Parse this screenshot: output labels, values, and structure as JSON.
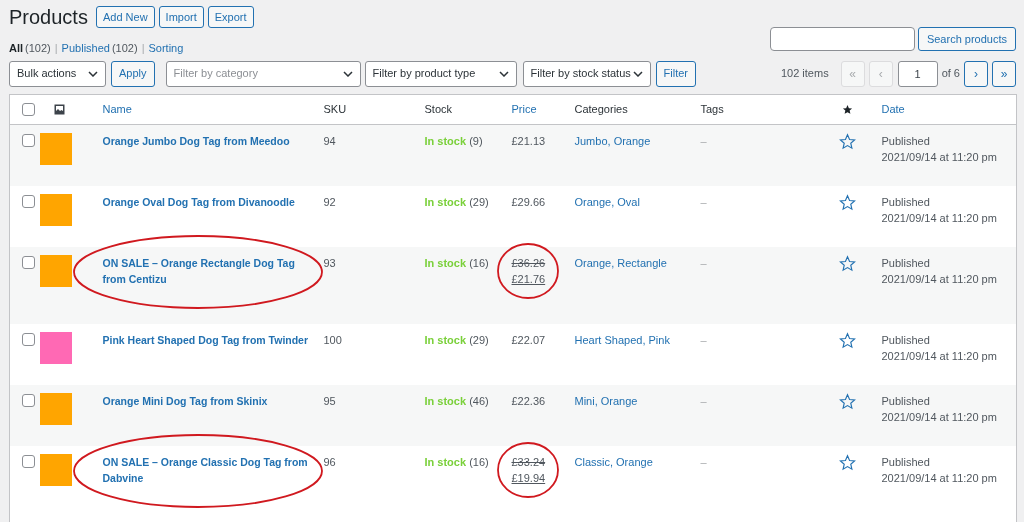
{
  "title": "Products",
  "header_buttons": [
    "Add New",
    "Import",
    "Export"
  ],
  "views": [
    {
      "label": "All",
      "count": "(102)",
      "selected": true
    },
    {
      "separator": "|",
      "label": "Published",
      "count": "(102)",
      "selected": false
    },
    {
      "separator": "|",
      "label": "Sorting",
      "selected": false
    }
  ],
  "select_all_checked": false,
  "search": {
    "button": "Search products"
  },
  "filters": {
    "bulk": "Bulk actions",
    "apply": "Apply",
    "selects": [
      "Filter by category",
      "Filter by product type",
      "Filter by stock status"
    ],
    "filter": "Filter"
  },
  "pagination": {
    "items": "102 items",
    "first": "«",
    "prev": "‹",
    "page": "1",
    "of": "of 6",
    "next": "›",
    "last": "»",
    "first_disabled": true,
    "prev_disabled": true
  },
  "table": {
    "columns": [
      "Name",
      "SKU",
      "Stock",
      "Price",
      "Categories",
      "Tags",
      "Date"
    ],
    "rows": [
      {
        "checked": false,
        "name": "Orange Jumbo Dog Tag from Meedoo",
        "sku": "94",
        "stock": "In stock",
        "qty": "(9)",
        "price": "£21.13",
        "categories": "Jumbo, Orange",
        "tags": "–",
        "featured": false,
        "date_status": "Published",
        "date": "2021/09/14 at 11:20 pm",
        "color": "#ffa500",
        "circled": false
      },
      {
        "checked": false,
        "name": "Orange Oval Dog Tag from Divanoodle",
        "sku": "92",
        "stock": "In stock",
        "qty": "(29)",
        "price": "£29.66",
        "categories": "Orange, Oval",
        "tags": "–",
        "featured": false,
        "date_status": "Published",
        "date": "2021/09/14 at 11:20 pm",
        "color": "#ffa500",
        "circled": false
      },
      {
        "checked": false,
        "name": "ON SALE – Orange Rectangle Dog Tag from Centizu",
        "sku": "93",
        "stock": "In stock",
        "qty": "(16)",
        "regular_price": "£36.26",
        "price": "£21.76",
        "categories": "Orange, Rectangle",
        "tags": "–",
        "featured": false,
        "date_status": "Published",
        "date": "2021/09/14 at 11:20 pm",
        "color": "#ffa500",
        "circled": true
      },
      {
        "checked": false,
        "name": "Pink Heart Shaped Dog Tag from Twinder",
        "sku": "100",
        "stock": "In stock",
        "qty": "(29)",
        "price": "£22.07",
        "categories": "Heart Shaped, Pink",
        "tags": "–",
        "featured": false,
        "date_status": "Published",
        "date": "2021/09/14 at 11:20 pm",
        "color": "#ff69b4",
        "circled": false
      },
      {
        "checked": false,
        "name": "Orange Mini Dog Tag from Skinix",
        "sku": "95",
        "stock": "In stock",
        "qty": "(46)",
        "price": "£22.36",
        "categories": "Mini, Orange",
        "tags": "–",
        "featured": false,
        "date_status": "Published",
        "date": "2021/09/14 at 11:20 pm",
        "color": "#ffa500",
        "circled": false
      },
      {
        "checked": false,
        "name": "ON SALE – Orange Classic Dog Tag from Dabvine",
        "sku": "96",
        "stock": "In stock",
        "qty": "(16)",
        "regular_price": "£33.24",
        "price": "£19.94",
        "categories": "Classic, Orange",
        "tags": "–",
        "featured": false,
        "date_status": "Published",
        "date": "2021/09/14 at 11:20 pm",
        "color": "#ffa500",
        "circled": true
      }
    ]
  }
}
